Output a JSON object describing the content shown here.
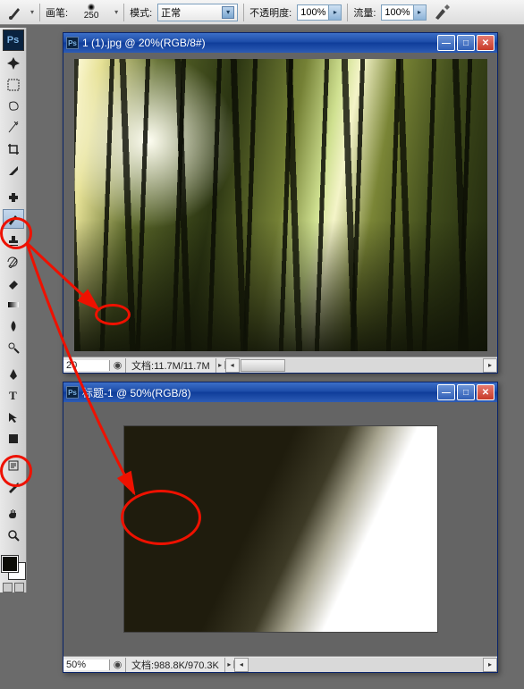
{
  "options_bar": {
    "brush_label": "画笔:",
    "brush_size": "250",
    "mode_label": "模式:",
    "mode_value": "正常",
    "opacity_label": "不透明度:",
    "opacity_value": "100%",
    "flow_label": "流量:",
    "flow_value": "100%"
  },
  "windows": {
    "win1": {
      "title": "1 (1).jpg @ 20%(RGB/8#)",
      "zoom": "20",
      "docinfo_label": "文档:",
      "docinfo_value": "11.7M/11.7M"
    },
    "win2": {
      "title": "标题-1 @ 50%(RGB/8)",
      "zoom": "50%",
      "docinfo_label": "文档:",
      "docinfo_value": "988.8K/970.3K"
    }
  },
  "tools": {
    "logo": "Ps"
  }
}
